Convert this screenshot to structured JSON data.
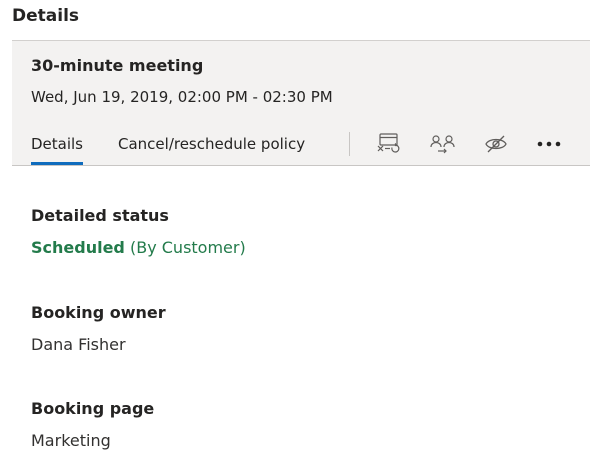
{
  "pane": {
    "title": "Details"
  },
  "booking": {
    "title": "30-minute meeting",
    "datetime": "Wed, Jun 19, 2019, 02:00 PM - 02:30 PM"
  },
  "tabs": [
    {
      "label": "Details",
      "active": true
    },
    {
      "label": "Cancel/reschedule policy",
      "active": false
    }
  ],
  "toolbar": {
    "icons": [
      "cancel-booking-icon",
      "reassign-staff-icon",
      "hide-icon",
      "more-icon"
    ]
  },
  "fields": {
    "detailed_status": {
      "label": "Detailed status",
      "status": "Scheduled",
      "detail": "(By Customer)"
    },
    "booking_owner": {
      "label": "Booking owner",
      "value": "Dana Fisher"
    },
    "booking_page": {
      "label": "Booking page",
      "value": "Marketing"
    }
  },
  "colors": {
    "accent": "#0f6cbd",
    "status_green": "#237b4b",
    "card_bg": "#f3f2f1"
  }
}
